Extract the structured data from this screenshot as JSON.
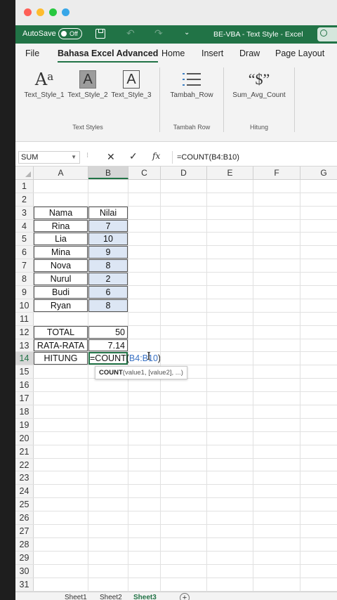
{
  "qat": {
    "autosave_label": "AutoSave",
    "autosave_state": "Off",
    "window_title": "BE-VBA - Text Style  -  Excel"
  },
  "tabs": [
    "File",
    "Bahasa Excel Advanced",
    "Home",
    "Insert",
    "Draw",
    "Page Layout"
  ],
  "ribbon": {
    "groups": [
      {
        "name": "Text Styles",
        "buttons": [
          "Text_Style_1",
          "Text_Style_2",
          "Text_Style_3"
        ]
      },
      {
        "name": "Tambah Row",
        "buttons": [
          "Tambah_Row"
        ]
      },
      {
        "name": "Hitung",
        "buttons": [
          "Sum_Avg_Count"
        ]
      }
    ]
  },
  "formula_bar": {
    "name_box": "SUM",
    "formula": "=COUNT(B4:B10)"
  },
  "columns": [
    "A",
    "B",
    "C",
    "D",
    "E",
    "F",
    "G"
  ],
  "rows": {
    "r3": {
      "a": "Nama",
      "b": "Nilai"
    },
    "r4": {
      "a": "Rina",
      "b": "7"
    },
    "r5": {
      "a": "Lia",
      "b": "10"
    },
    "r6": {
      "a": "Mina",
      "b": "9"
    },
    "r7": {
      "a": "Nova",
      "b": "8"
    },
    "r8": {
      "a": "Nurul",
      "b": "2"
    },
    "r9": {
      "a": "Budi",
      "b": "6"
    },
    "r10": {
      "a": "Ryan",
      "b": "8"
    },
    "r12": {
      "a": "TOTAL",
      "b": "50"
    },
    "r13": {
      "a": "RATA-RATA",
      "b": "7.14"
    },
    "r14": {
      "a": "HITUNG",
      "b_prefix": "=COUNT(",
      "b_ref": "B4:B10",
      "b_suffix": ")"
    }
  },
  "tooltip": {
    "fn": "COUNT",
    "args": "(value1, [value2], ...)"
  },
  "sheets": [
    "Sheet1",
    "Sheet2",
    "Sheet3"
  ],
  "active_sheet": "Sheet3"
}
